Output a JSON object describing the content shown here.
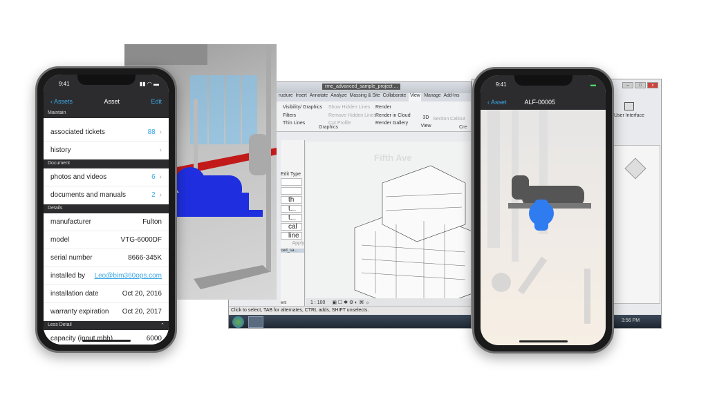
{
  "revit": {
    "quick_access_project": "rme_advanced_sample_project ...",
    "tabs": [
      "ructure",
      "Insert",
      "Annotate",
      "Analyze",
      "Massing & Site",
      "Collaborate",
      "View",
      "Manage",
      "Add-Ins"
    ],
    "active_tab": "View",
    "graphics": [
      "Visibility/ Graphics",
      "Filters",
      "Thin Lines"
    ],
    "graphics_disabled": [
      "Show Hidden Lines",
      "Remove Hidden Lines",
      "Cut Profile"
    ],
    "render": [
      "Render",
      "Render in Cloud",
      "Render Gallery"
    ],
    "view_3d": "3D View",
    "section": "Section",
    "callout": "Callout",
    "panel_label": "Graphics",
    "panel_cre": "Cre",
    "edit_type": "Edit Type",
    "apply": "Apply",
    "prop_snips": [
      "th",
      "t...",
      "t...",
      "cal",
      "line"
    ],
    "browser_tab": "ced_sa...",
    "browser_snip": "ent",
    "view_title": "Fifth Ave",
    "scale": "1 : 100",
    "status_text": "Click to select, TAB for alternates, CTRL adds, SHIFT unselects."
  },
  "right_window": {
    "user_interface": "User Interface",
    "clock": "3:56 PM",
    "controls": [
      "–",
      "□",
      "x"
    ]
  },
  "left_phone": {
    "time": "9:41",
    "back": "Assets",
    "title": "Asset",
    "edit": "Edit",
    "sections": [
      {
        "header": "Maintain",
        "rows": [
          {
            "label": "associated tickets",
            "value": "88",
            "chevron": true
          },
          {
            "label": "history",
            "value": "",
            "chevron": true
          }
        ]
      },
      {
        "header": "Document",
        "rows": [
          {
            "label": "photos and videos",
            "value": "6",
            "chevron": true
          },
          {
            "label": "documents and manuals",
            "value": "2",
            "chevron": true
          }
        ]
      },
      {
        "header": "Details",
        "rows": [
          {
            "label": "manufacturer",
            "value": "Fulton"
          },
          {
            "label": "model",
            "value": "VTG-6000DF"
          },
          {
            "label": "serial number",
            "value": "8666-345K"
          },
          {
            "label": "installed by",
            "value": "Leo@bim360ops.com"
          },
          {
            "label": "installation date",
            "value": "Oct 20, 2016"
          },
          {
            "label": "warranty expiration",
            "value": "Oct 20, 2017"
          }
        ]
      },
      {
        "header": "Less Detail",
        "rows": [
          {
            "label": "capacity (input mbh)",
            "value": "6000"
          }
        ]
      }
    ]
  },
  "right_phone": {
    "time": "9:41",
    "back": "Asset",
    "title": "ALF-00005"
  },
  "colors": {
    "accent": "#3ea8e6",
    "pump_blue": "#1f2fe0",
    "pipe_red": "#c21a1a",
    "selected_blue": "#2f7cf0"
  }
}
